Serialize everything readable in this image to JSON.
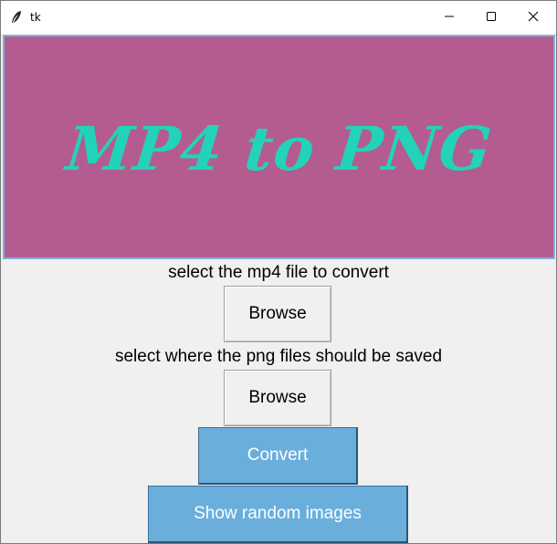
{
  "window": {
    "title": "tk",
    "minimize_icon": "minimize-icon",
    "maximize_icon": "maximize-icon",
    "close_icon": "close-icon",
    "app_icon": "feather-icon"
  },
  "banner": {
    "text": "MP4 to PNG",
    "background_color": "#b45c8f",
    "text_color": "#22d3b9"
  },
  "input_section": {
    "label": "select the mp4 file to convert",
    "browse_label": "Browse"
  },
  "output_section": {
    "label": "select where the png files should be saved",
    "browse_label": "Browse"
  },
  "actions": {
    "convert_label": "Convert",
    "random_label": "Show random images",
    "button_color": "#6aafdc"
  }
}
